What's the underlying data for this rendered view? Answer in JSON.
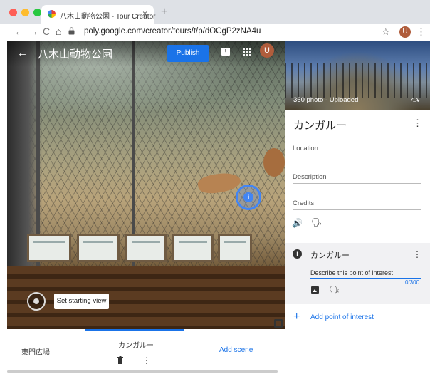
{
  "browser": {
    "tab_title": "八木山動物公園 - Tour Creator",
    "tab_close": "×",
    "new_tab": "+",
    "back": "←",
    "forward": "→",
    "reload": "C",
    "home": "⌂",
    "url": "poly.google.com/creator/tours/t/p/dOCgP2zNA4u",
    "star": "☆",
    "profile_initial": "U",
    "menu": "⋮",
    "traffic_light_colors": [
      "#fe5f57",
      "#febc2e",
      "#28c840"
    ]
  },
  "app": {
    "back": "←",
    "tour_title": "八木山動物公園",
    "title_menu": "⋮",
    "publish_label": "Publish",
    "feedback_icon": "!",
    "profile_initial": "U"
  },
  "viewer": {
    "poi_marker_label": "i",
    "set_starting_view_label": "Set starting view"
  },
  "scenes": {
    "items": [
      "東門広場",
      "カンガルー"
    ],
    "selected_index": 1,
    "add_scene_label": "Add scene",
    "menu": "⋮"
  },
  "panel": {
    "photo_label": "360 photo - Uploaded",
    "photo_action_icon": "⤼",
    "scene_name": "カンガルー",
    "scene_menu": "⋮",
    "location_label": "Location",
    "description_label": "Description",
    "credits_label": "Credits",
    "audio_icon": "🔊",
    "narration_icon": "🗣",
    "poi": {
      "icon": "i",
      "name": "カンガルー",
      "menu": "⋮",
      "description_placeholder": "Describe this point of interest",
      "char_count": "0/300",
      "narration_icon": "🗣"
    },
    "add_poi_plus": "+",
    "add_poi_label": "Add point of interest"
  },
  "colors": {
    "accent": "#1a73e8",
    "avatar": "#b05d3c"
  }
}
